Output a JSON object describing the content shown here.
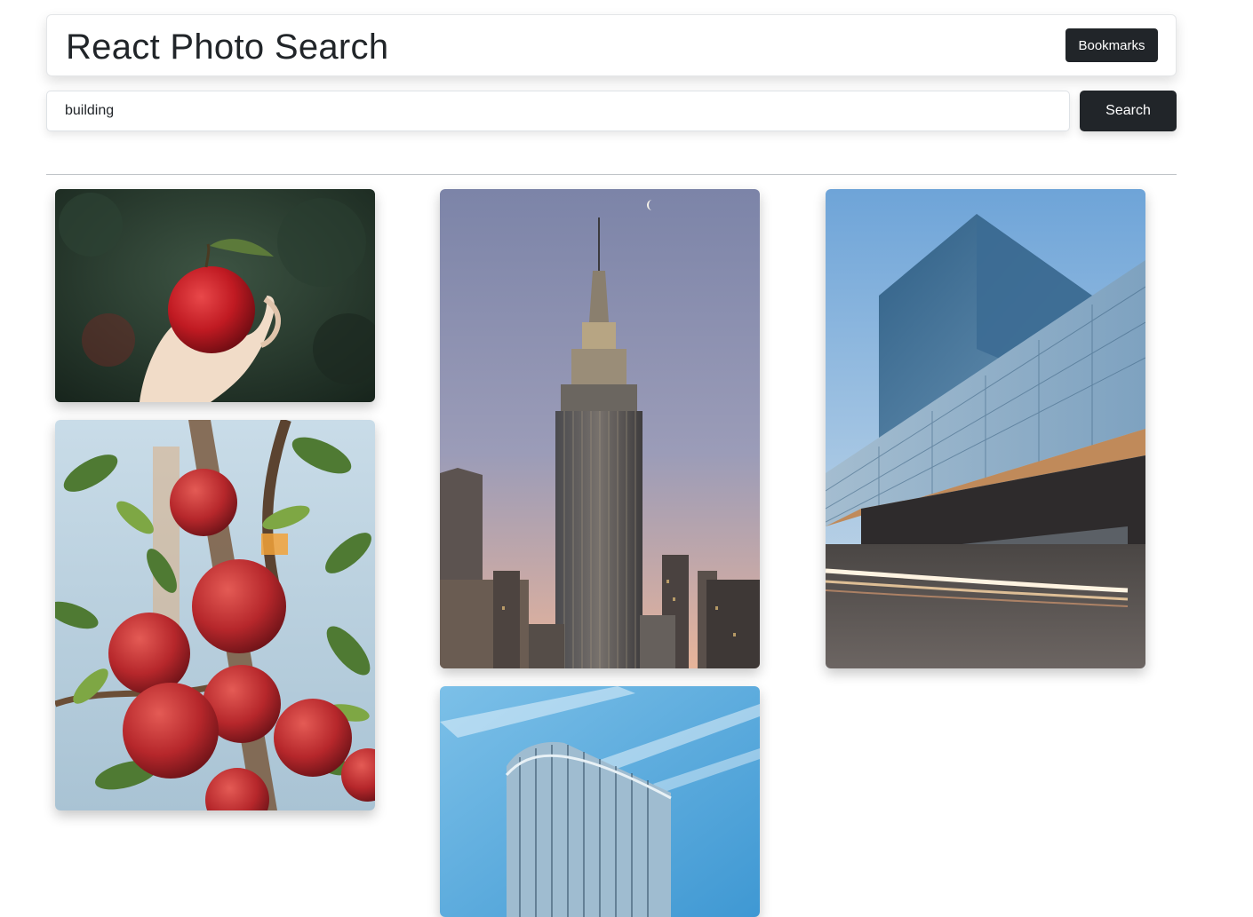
{
  "header": {
    "title": "React Photo Search",
    "bookmarks_label": "Bookmarks"
  },
  "search": {
    "value": "building",
    "button_label": "Search"
  },
  "photos": [
    {
      "subject": "hand holding red apple",
      "column": 1
    },
    {
      "subject": "apples on tree branch",
      "column": 1
    },
    {
      "subject": "empire state building at dusk",
      "column": 2
    },
    {
      "subject": "glass office building facade",
      "column": 2
    },
    {
      "subject": "glass building with light trails",
      "column": 3
    }
  ],
  "colors": {
    "primary_dark": "#212529",
    "divider": "#bfc3c7"
  }
}
